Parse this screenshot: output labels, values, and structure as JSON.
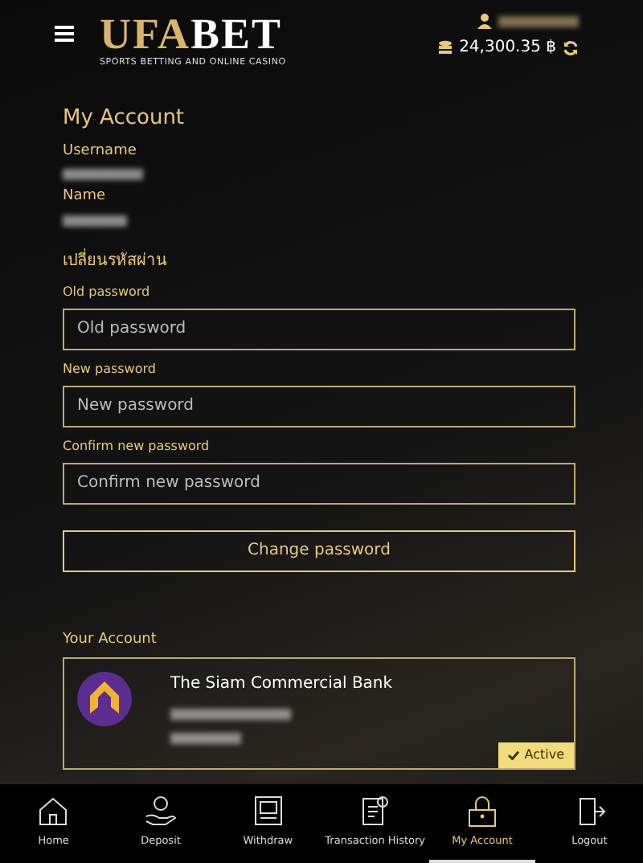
{
  "header": {
    "logo": "UFABET",
    "tagline": "SPORTS BETTING AND ONLINE CASINO",
    "balance": "24,300.35 ฿"
  },
  "account": {
    "title": "My Account",
    "username_label": "Username",
    "name_label": "Name"
  },
  "password_form": {
    "title": "เปลี่ยนรหัสผ่าน",
    "fields": [
      {
        "label": "Old password",
        "placeholder": "Old password"
      },
      {
        "label": "New password",
        "placeholder": "New password"
      },
      {
        "label": "Confirm new password",
        "placeholder": "Confirm new password"
      }
    ],
    "button": "Change password"
  },
  "bank": {
    "title": "Your Account",
    "bank_name": "The Siam Commercial Bank",
    "status": "Active",
    "active": true
  },
  "nav": [
    {
      "label": "Home",
      "kind": "home",
      "selected": false
    },
    {
      "label": "Deposit",
      "kind": "deposit",
      "selected": false
    },
    {
      "label": "Withdraw",
      "kind": "withdraw",
      "selected": false
    },
    {
      "label": "Transaction History",
      "kind": "history",
      "selected": false
    },
    {
      "label": "My Account",
      "kind": "lock",
      "selected": true
    },
    {
      "label": "Logout",
      "kind": "logout",
      "selected": false
    }
  ]
}
